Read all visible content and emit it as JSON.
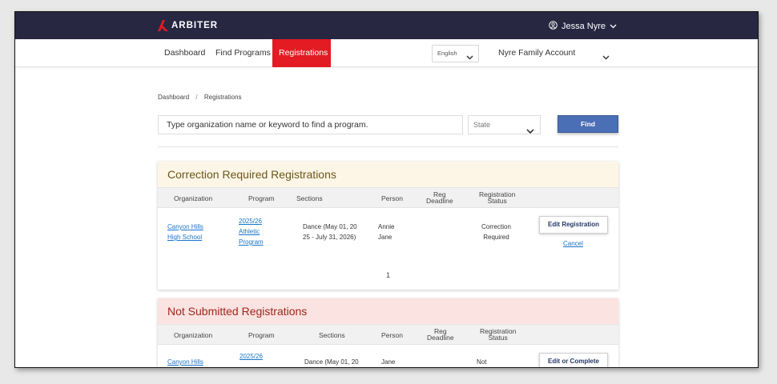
{
  "brand": {
    "name": "ARBITER",
    "accent": "#e31b23"
  },
  "user": {
    "name": "Jessa Nyre",
    "icon": "user-circle-icon"
  },
  "nav": {
    "items": [
      {
        "label": "Dashboard",
        "active": false
      },
      {
        "label": "Find Programs",
        "active": false
      },
      {
        "label": "Registrations",
        "active": true
      }
    ],
    "language": "English",
    "account": "Nyre Family Account"
  },
  "breadcrumb": {
    "home": "Dashboard",
    "separator": "/",
    "current": "Registrations"
  },
  "search": {
    "placeholder": "Type organization name or keyword to find a program.",
    "state_placeholder": "State",
    "find_label": "Find"
  },
  "columns": {
    "organization": "Organization",
    "program": "Program",
    "sections": "Sections",
    "person": "Person",
    "reg_deadline_1": "Reg",
    "reg_deadline_2": "Deadline",
    "reg_status_1": "Registration",
    "reg_status_2": "Status"
  },
  "correction": {
    "title": "Correction Required Registrations",
    "row": {
      "org_1": "Canyon Hills",
      "org_2": "High School",
      "prog_1": "2025/26",
      "prog_2": "Athletic",
      "prog_3": "Program",
      "sec_1": "Dance (May 01, 20",
      "sec_2": "25 - July 31, 2026)",
      "person_1": "Annie",
      "person_2": "Jane",
      "status_1": "Correction",
      "status_2": "Required",
      "action": "Edit Registration",
      "cancel": "Cancel"
    },
    "page": "1"
  },
  "not_submitted": {
    "title": "Not Submitted Registrations",
    "row": {
      "org_1": "Canyon Hills",
      "prog_1": "2025/26",
      "sec_1": "Dance (May 01, 20",
      "person_1": "Jane",
      "status_1": "Not",
      "action": "Edit or Complete"
    }
  }
}
